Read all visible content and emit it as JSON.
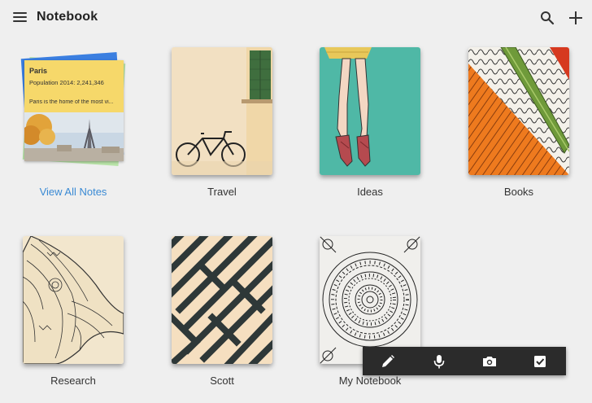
{
  "header": {
    "title": "Notebook"
  },
  "all_notes": {
    "label": "View All Notes",
    "note_title": "Paris",
    "note_line1": "Population 2014: 2,241,346",
    "note_line2": "Paris is the home of the most vi..."
  },
  "notebooks": [
    {
      "label": "Travel"
    },
    {
      "label": "Ideas"
    },
    {
      "label": "Books"
    },
    {
      "label": "Research"
    },
    {
      "label": "Scott"
    },
    {
      "label": "My Notebook"
    }
  ],
  "quick_actions": [
    "pencil-icon",
    "microphone-icon",
    "camera-icon",
    "checkbox-icon"
  ],
  "colors": {
    "link": "#3a8ad4",
    "teal": "#4fb8a6",
    "sticky": "#f6d86a",
    "bar": "#2b2b2b"
  }
}
